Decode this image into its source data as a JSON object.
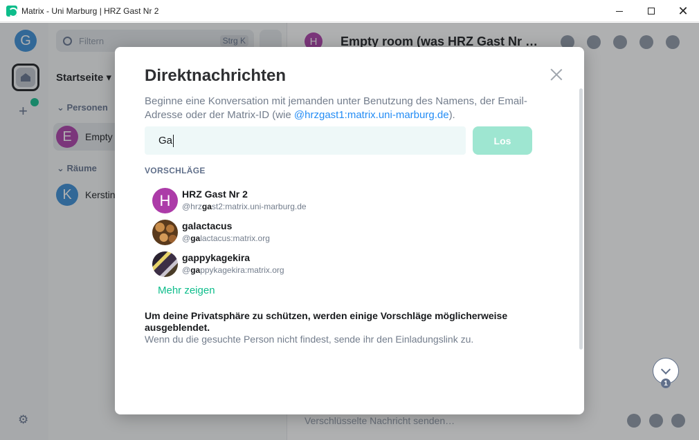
{
  "window": {
    "title": "Matrix - Uni Marburg | HRZ Gast Nr 2",
    "controls": {
      "minimize": "",
      "maximize": "",
      "close": "✕"
    }
  },
  "spaces": {
    "account_initial": "G",
    "settings_icon": "⚙"
  },
  "roomlist": {
    "filter_placeholder": "Filtern",
    "filter_shortcut": "Strg K",
    "home_title": "Startseite",
    "section_people": "Personen",
    "section_rooms": "Räume",
    "people": [
      {
        "initial": "E",
        "name": "Empty",
        "color": "#ac3ba8"
      }
    ],
    "rooms": [
      {
        "initial": "K",
        "name": "Kerstin",
        "color": "#368bd6"
      }
    ]
  },
  "room": {
    "avatar_initial": "H",
    "name": "Empty room (was HRZ Gast Nr …",
    "composer_placeholder": "Verschlüsselte Nachricht senden…",
    "unread_count": "1"
  },
  "dialog": {
    "title": "Direktnachrichten",
    "description_before": "Beginne eine Konversation mit jemanden unter Benutzung des Namens, der Email-Adresse oder der Matrix-ID (wie ",
    "description_link": "@hrzgast1:matrix.uni-marburg.de",
    "description_after": ").",
    "search_value": "Ga",
    "go_button": "Los",
    "suggestions_heading": "VORSCHLÄGE",
    "suggestions": [
      {
        "name": "HRZ Gast Nr 2",
        "id_before": "@hrz",
        "id_match": "ga",
        "id_after": "st2:matrix.uni-marburg.de",
        "initial": "H",
        "color": "#ac3ba8",
        "avatar": "letter"
      },
      {
        "name": "galactacus",
        "id_before": "@",
        "id_match": "ga",
        "id_after": "lactacus:matrix.org",
        "initial": "",
        "color": "#6b4a2a",
        "avatar": "image"
      },
      {
        "name": "gappykagekira",
        "id_before": "@",
        "id_match": "ga",
        "id_after": "ppykagekira:matrix.org",
        "initial": "",
        "color": "#3c2f45",
        "avatar": "image"
      }
    ],
    "more_link": "Mehr zeigen",
    "privacy_bold": "Um deine Privatsphäre zu schützen, werden einige Vorschläge möglicherweise ausgeblendet.",
    "privacy_text": "Wenn du die gesuchte Person nicht findest, sende ihr den Einladungslink zu."
  },
  "colors": {
    "accent": "#0dbd8b",
    "link": "#238cf5",
    "go_button_disabled": "#9ee6d1"
  }
}
